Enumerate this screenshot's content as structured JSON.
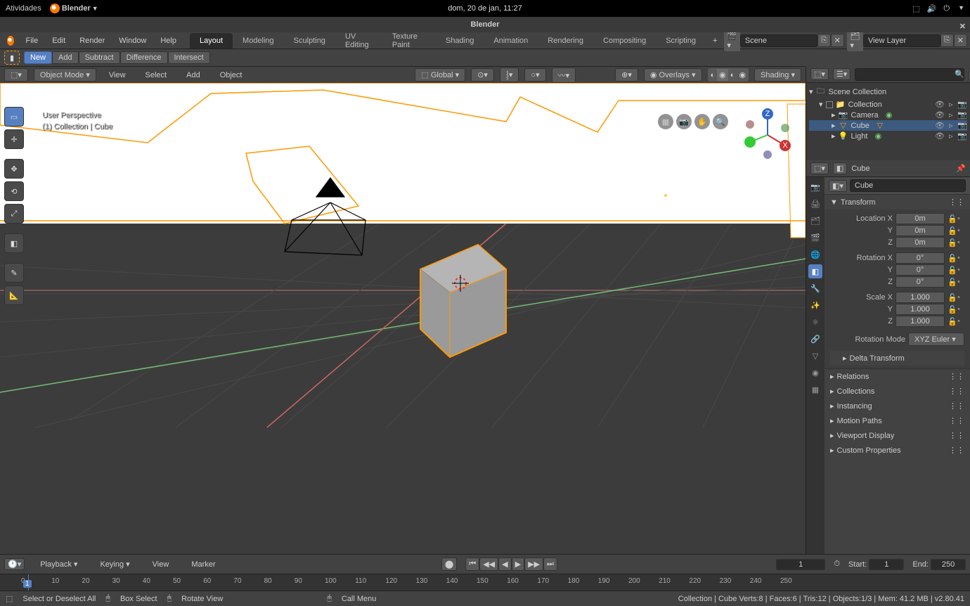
{
  "os": {
    "activities": "Atividades",
    "app": "Blender",
    "date": "dom, 20 de jan, 11:27"
  },
  "window": {
    "title": "Blender"
  },
  "menu": {
    "file": "File",
    "edit": "Edit",
    "render": "Render",
    "window": "Window",
    "help": "Help"
  },
  "tabs": [
    "Layout",
    "Modeling",
    "Sculpting",
    "UV Editing",
    "Texture Paint",
    "Shading",
    "Animation",
    "Rendering",
    "Compositing",
    "Scripting"
  ],
  "scene_field": "Scene",
  "viewlayer_field": "View Layer",
  "booltools": {
    "new": "New",
    "add": "Add",
    "subtract": "Subtract",
    "difference": "Difference",
    "intersect": "Intersect"
  },
  "vpheader": {
    "mode": "Object Mode",
    "view": "View",
    "select": "Select",
    "add": "Add",
    "object": "Object",
    "orient": "Global",
    "overlays": "Overlays",
    "shading": "Shading"
  },
  "vpinfo": {
    "line1": "User Perspective",
    "line2": "(1) Collection | Cube"
  },
  "outliner": {
    "root": "Scene Collection",
    "items": [
      {
        "name": "Collection",
        "icon": "📁"
      },
      {
        "name": "Camera",
        "icon": "📷"
      },
      {
        "name": "Cube",
        "icon": "▽"
      },
      {
        "name": "Light",
        "icon": "💡"
      }
    ]
  },
  "props": {
    "object": "Cube",
    "name": "Cube",
    "transform_label": "Transform",
    "location": {
      "xlabel": "Location X",
      "x": "0m",
      "y": "0m",
      "z": "0m"
    },
    "rotation": {
      "xlabel": "Rotation X",
      "x": "0°",
      "y": "0°",
      "z": "0°"
    },
    "scale": {
      "xlabel": "Scale X",
      "x": "1.000",
      "y": "1.000",
      "z": "1.000"
    },
    "rotmode_label": "Rotation Mode",
    "rotmode": "XYZ Euler",
    "panels": [
      "Delta Transform",
      "Relations",
      "Collections",
      "Instancing",
      "Motion Paths",
      "Viewport Display",
      "Custom Properties"
    ]
  },
  "timeline": {
    "playback": "Playback",
    "keying": "Keying",
    "view": "View",
    "marker": "Marker",
    "frame": "1",
    "start_label": "Start:",
    "start": "1",
    "end_label": "End:",
    "end": "250"
  },
  "ruler": {
    "ticks": [
      "0",
      "10",
      "20",
      "30",
      "40",
      "50",
      "60",
      "70",
      "80",
      "90",
      "100",
      "110",
      "120",
      "130",
      "140",
      "150",
      "160",
      "170",
      "180",
      "190",
      "200",
      "210",
      "220",
      "230",
      "240",
      "250"
    ],
    "current": "1"
  },
  "status": {
    "hints": [
      {
        "icon": "🖱",
        "text": "Select or Deselect All"
      },
      {
        "icon": "🖱",
        "text": "Box Select"
      },
      {
        "icon": "🖱",
        "text": "Rotate View"
      },
      {
        "icon": "🖱",
        "text": "Call Menu"
      }
    ],
    "right": "Collection | Cube   Verts:8 | Faces:6 | Tris:12 | Objects:1/3 | Mem: 41.2 MB | v2.80.41"
  },
  "colors": {
    "accent": "#5680C2",
    "orange": "#f57900"
  }
}
